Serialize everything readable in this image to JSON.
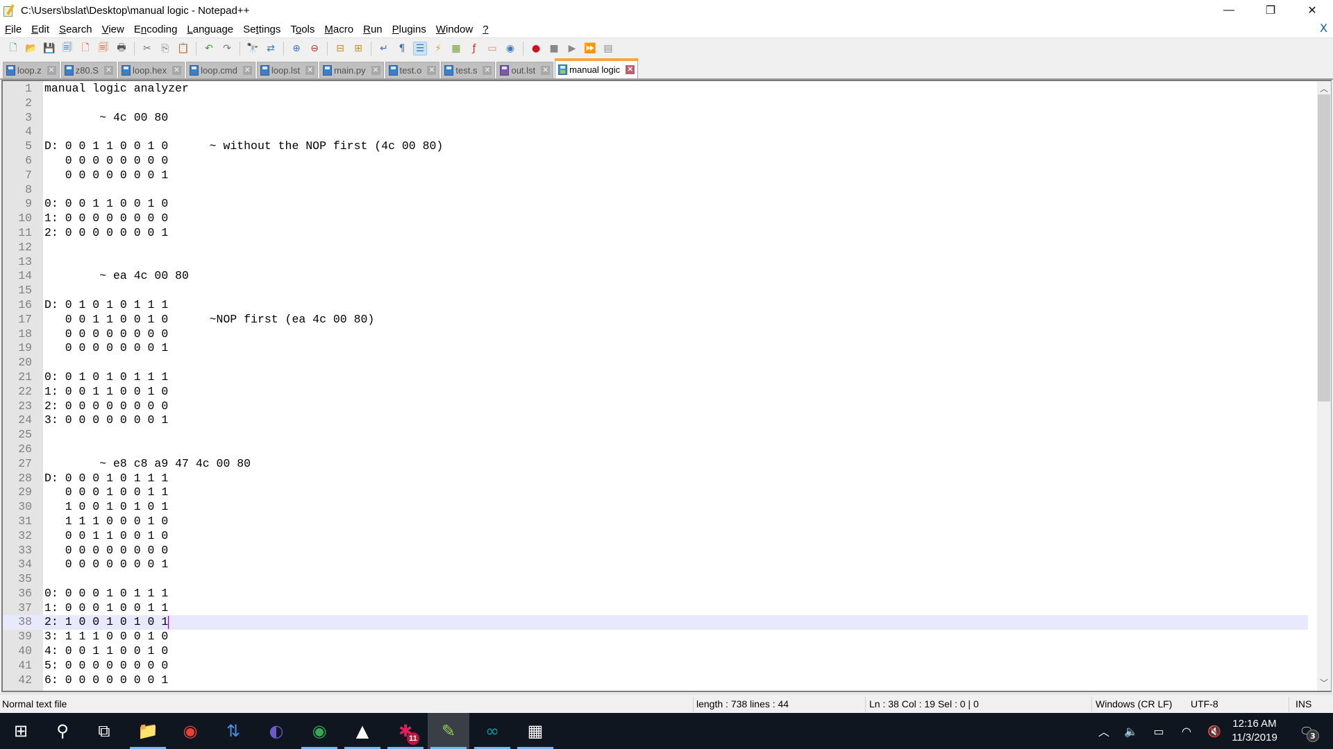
{
  "window": {
    "title": "C:\\Users\\bslat\\Desktop\\manual logic - Notepad++",
    "minimize": "—",
    "restore": "❐",
    "close": "✕",
    "doc_close": "X"
  },
  "menu": [
    {
      "label": "File",
      "u": "F",
      "rest": "ile"
    },
    {
      "label": "Edit",
      "u": "E",
      "rest": "dit"
    },
    {
      "label": "Search",
      "u": "S",
      "rest": "earch"
    },
    {
      "label": "View",
      "u": "V",
      "rest": "iew"
    },
    {
      "label": "Encoding",
      "pre": "E",
      "u": "n",
      "rest": "coding"
    },
    {
      "label": "Language",
      "u": "L",
      "rest": "anguage"
    },
    {
      "label": "Settings",
      "pre": "Se",
      "u": "t",
      "rest": "tings"
    },
    {
      "label": "Tools",
      "pre": "T",
      "u": "o",
      "rest": "ols"
    },
    {
      "label": "Macro",
      "u": "M",
      "rest": "acro"
    },
    {
      "label": "Run",
      "u": "R",
      "rest": "un"
    },
    {
      "label": "Plugins",
      "u": "P",
      "rest": "lugins"
    },
    {
      "label": "Window",
      "u": "W",
      "rest": "indow"
    },
    {
      "label": "?",
      "u": "?",
      "rest": ""
    }
  ],
  "toolbar": [
    {
      "name": "new-file",
      "glyph": "🗋",
      "color": "#3a9a3a"
    },
    {
      "name": "open-file",
      "glyph": "📂",
      "color": "#e0a030"
    },
    {
      "name": "save",
      "glyph": "💾",
      "color": "#555"
    },
    {
      "name": "save-all",
      "glyph": "🗐",
      "color": "#3a6fb0"
    },
    {
      "name": "close",
      "glyph": "🗋",
      "color": "#d05020"
    },
    {
      "name": "close-all",
      "glyph": "🗐",
      "color": "#d05020"
    },
    {
      "name": "print",
      "glyph": "🖶",
      "color": "#555"
    },
    {
      "sep": true
    },
    {
      "name": "cut",
      "glyph": "✂",
      "color": "#777"
    },
    {
      "name": "copy",
      "glyph": "⎘",
      "color": "#777"
    },
    {
      "name": "paste",
      "glyph": "📋",
      "color": "#c08020"
    },
    {
      "sep": true
    },
    {
      "name": "undo",
      "glyph": "↶",
      "color": "#3a9a3a"
    },
    {
      "name": "redo",
      "glyph": "↷",
      "color": "#777"
    },
    {
      "sep": true
    },
    {
      "name": "find",
      "glyph": "🔭",
      "color": "#333"
    },
    {
      "name": "replace",
      "glyph": "⇄",
      "color": "#3a7ac0"
    },
    {
      "sep": true
    },
    {
      "name": "zoom-in",
      "glyph": "⊕",
      "color": "#3a7ac0"
    },
    {
      "name": "zoom-out",
      "glyph": "⊖",
      "color": "#c03030"
    },
    {
      "sep": true
    },
    {
      "name": "sync-vertical",
      "glyph": "⊟",
      "color": "#c09030"
    },
    {
      "name": "sync-horizontal",
      "glyph": "⊞",
      "color": "#c09030"
    },
    {
      "sep": true
    },
    {
      "name": "word-wrap",
      "glyph": "↵",
      "color": "#3a6fb0"
    },
    {
      "name": "show-all-chars",
      "glyph": "¶",
      "color": "#3a6fb0"
    },
    {
      "name": "indent-guide",
      "glyph": "☰",
      "color": "#3a6fb0",
      "active": true
    },
    {
      "name": "define-language",
      "glyph": "⚡",
      "color": "#e0a030"
    },
    {
      "name": "document-map",
      "glyph": "▦",
      "color": "#70a030"
    },
    {
      "name": "function-list",
      "glyph": "ƒ",
      "color": "#c03030"
    },
    {
      "name": "folder-as-workspace",
      "glyph": "▭",
      "color": "#e08080"
    },
    {
      "name": "monitoring",
      "glyph": "◉",
      "color": "#3a7ac0"
    },
    {
      "sep": true
    },
    {
      "name": "record-macro",
      "glyph": "●",
      "color": "#d01020"
    },
    {
      "name": "stop-recording",
      "glyph": "■",
      "color": "#888"
    },
    {
      "name": "playback-macro",
      "glyph": "▶",
      "color": "#888"
    },
    {
      "name": "run-macro-multiple",
      "glyph": "⏩",
      "color": "#3a6fb0"
    },
    {
      "name": "save-macro",
      "glyph": "▤",
      "color": "#888"
    }
  ],
  "tabs": [
    {
      "label": "loop.z",
      "active": false
    },
    {
      "label": "z80.S",
      "active": false
    },
    {
      "label": "loop.hex",
      "active": false
    },
    {
      "label": "loop.cmd",
      "active": false
    },
    {
      "label": "loop.lst",
      "active": false
    },
    {
      "label": "main.py",
      "active": false
    },
    {
      "label": "test.o",
      "active": false
    },
    {
      "label": "test.s",
      "active": false
    },
    {
      "label": "out.lst",
      "active": false,
      "purple": true
    },
    {
      "label": "manual logic",
      "active": true
    }
  ],
  "editor": {
    "current_line": 38,
    "caret_col": 19,
    "lines": [
      "manual logic analyzer",
      "",
      "        ~ 4c 00 80",
      "",
      "D: 0 0 1 1 0 0 1 0      ~ without the NOP first (4c 00 80)",
      "   0 0 0 0 0 0 0 0",
      "   0 0 0 0 0 0 0 1",
      "",
      "0: 0 0 1 1 0 0 1 0",
      "1: 0 0 0 0 0 0 0 0",
      "2: 0 0 0 0 0 0 0 1",
      "",
      "",
      "        ~ ea 4c 00 80",
      "",
      "D: 0 1 0 1 0 1 1 1",
      "   0 0 1 1 0 0 1 0      ~NOP first (ea 4c 00 80)",
      "   0 0 0 0 0 0 0 0",
      "   0 0 0 0 0 0 0 1",
      "",
      "0: 0 1 0 1 0 1 1 1",
      "1: 0 0 1 1 0 0 1 0",
      "2: 0 0 0 0 0 0 0 0",
      "3: 0 0 0 0 0 0 0 1",
      "",
      "",
      "        ~ e8 c8 a9 47 4c 00 80",
      "D: 0 0 0 1 0 1 1 1",
      "   0 0 0 1 0 0 1 1",
      "   1 0 0 1 0 1 0 1",
      "   1 1 1 0 0 0 1 0",
      "   0 0 1 1 0 0 1 0",
      "   0 0 0 0 0 0 0 0",
      "   0 0 0 0 0 0 0 1",
      "",
      "0: 0 0 0 1 0 1 1 1",
      "1: 0 0 0 1 0 0 1 1",
      "2: 1 0 0 1 0 1 0 1",
      "3: 1 1 1 0 0 0 1 0",
      "4: 0 0 1 1 0 0 1 0",
      "5: 0 0 0 0 0 0 0 0",
      "6: 0 0 0 0 0 0 0 1"
    ],
    "scroll_up": "︿",
    "scroll_down": "﹀"
  },
  "status": {
    "file_type": "Normal text file",
    "length_lines": "length : 738    lines : 44",
    "position": "Ln : 38    Col : 19    Sel : 0 | 0",
    "eol": "Windows (CR LF)",
    "encoding": "UTF-8",
    "mode": "INS"
  },
  "taskbar": {
    "apps": [
      {
        "name": "start",
        "glyph": "⊞",
        "color": "#ffffff"
      },
      {
        "name": "search",
        "glyph": "⚲",
        "color": "#ffffff"
      },
      {
        "name": "task-view",
        "glyph": "⧉",
        "color": "#ffffff"
      },
      {
        "name": "file-explorer",
        "glyph": "📁",
        "color": "#f5c342",
        "running": true
      },
      {
        "name": "chrome",
        "glyph": "◉",
        "color": "#e94235"
      },
      {
        "name": "network-connections",
        "glyph": "⇅",
        "color": "#4a90e2"
      },
      {
        "name": "eclipse",
        "glyph": "◐",
        "color": "#6a5acd"
      },
      {
        "name": "chrome-profile",
        "glyph": "◉",
        "color": "#34a853",
        "running": true
      },
      {
        "name": "photos",
        "glyph": "▲",
        "color": "#ffffff",
        "running": true
      },
      {
        "name": "slack",
        "glyph": "✱",
        "color": "#e01e5a",
        "running": true,
        "badge": "11"
      },
      {
        "name": "notepad-plus-plus",
        "glyph": "✎",
        "color": "#90d050",
        "running": true,
        "active": true
      },
      {
        "name": "arduino",
        "glyph": "∞",
        "color": "#00979d",
        "running": true
      },
      {
        "name": "calculator",
        "glyph": "▦",
        "color": "#ffffff",
        "running": true
      }
    ],
    "tray": {
      "show_hidden": "︿",
      "speaker_app": "🔈",
      "battery": "▭",
      "wifi": "◠",
      "volume_muted": "🔇",
      "time": "12:16 AM",
      "date": "11/3/2019",
      "notifications": "🗨",
      "notification_count": "3"
    }
  }
}
